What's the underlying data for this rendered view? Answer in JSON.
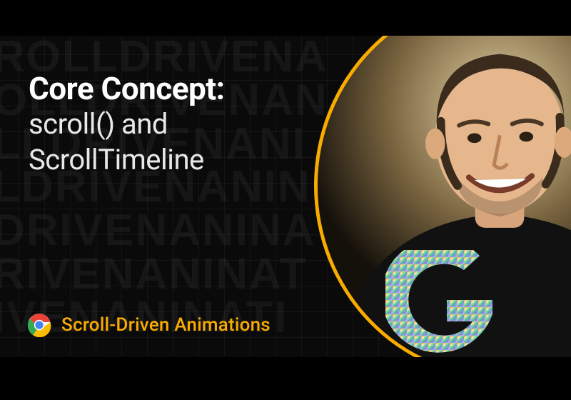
{
  "heading": {
    "title": "Core Concept:",
    "subtitle_line1": "scroll() and",
    "subtitle_line2": "ScrollTimeline"
  },
  "footer": {
    "series_title": "Scroll-Driven Animations"
  },
  "background": {
    "watermark_text": "ROLLDRIVENA\nOLLDRIVENAN\nLLDRIVENANI\nLDRIVENANIN\nDRIVENANINA\nRIVENANINAT\nIVENANINATI"
  },
  "icons": {
    "chrome": "chrome-icon",
    "g_logo": "g-logo"
  },
  "colors": {
    "accent": "#f9ab00",
    "bg": "#0a0a0a"
  }
}
